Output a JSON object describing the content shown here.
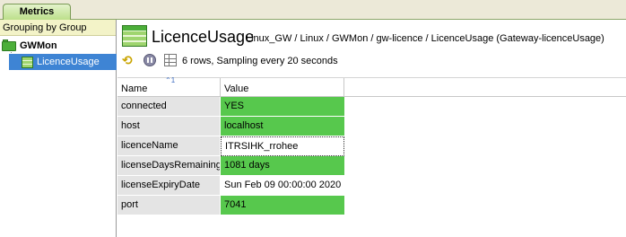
{
  "tab": {
    "label": "Metrics"
  },
  "tree": {
    "header": "Grouping by Group",
    "group": "GWMon",
    "item": "LicenceUsage"
  },
  "view": {
    "title": "LicenceUsage",
    "path": "Linux_GW / Linux / GWMon / gw-licence / LicenceUsage (Gateway-licenceUsage)",
    "status": "6 rows, Sampling every 20 seconds"
  },
  "table": {
    "headers": {
      "name": "Name",
      "value": "Value",
      "sort_indicator": "1"
    },
    "rows": [
      {
        "name": "connected",
        "value": "YES",
        "state": "ok"
      },
      {
        "name": "host",
        "value": "localhost",
        "state": "ok"
      },
      {
        "name": "licenceName",
        "value": "ITRSIHK_rrohee",
        "state": "selected"
      },
      {
        "name": "licenseDaysRemaining",
        "value": "1081 days",
        "state": "ok"
      },
      {
        "name": "licenseExpiryDate",
        "value": "Sun Feb 09 00:00:00 2020",
        "state": "plain"
      },
      {
        "name": "port",
        "value": "7041",
        "state": "ok"
      }
    ]
  },
  "colors": {
    "ok": "#57c84d",
    "selection": "#3e84d4",
    "tab": "#b9de86"
  },
  "icons": [
    "refresh-icon",
    "pause-icon",
    "grid-icon",
    "sampler-icon",
    "folder-icon"
  ]
}
